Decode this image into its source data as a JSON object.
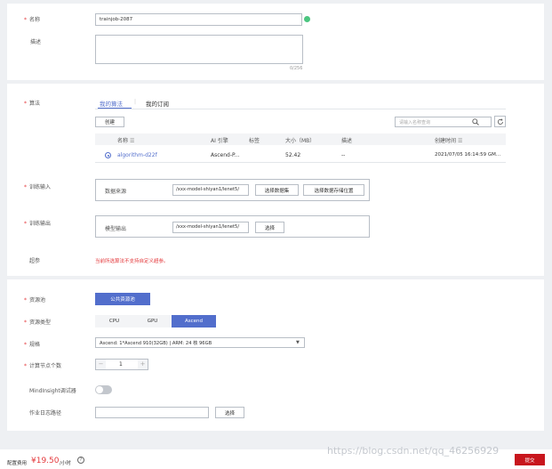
{
  "basic": {
    "name_label": "名称",
    "name_value": "trainjob-2087",
    "desc_label": "描述",
    "desc_count": "0/256"
  },
  "algo": {
    "label": "算法",
    "tabs": [
      "我的算法",
      "我的订阅"
    ],
    "create_btn": "创建",
    "search_placeholder": "请输入名称查询",
    "columns": [
      "名称",
      "AI 引擎",
      "标签",
      "大小（MB）",
      "描述",
      "创建时间"
    ],
    "row": {
      "name": "algorithm-d22f",
      "engine": "Ascend-P...",
      "tag": "",
      "size": "52.42",
      "desc": "--",
      "created": "2021/07/05 16:14:59 GM..."
    },
    "train_input_label": "训练输入",
    "data_source_label": "数据来源",
    "input_path": "/xxx-model-shiyan1/lenet5/",
    "select_dataset_btn": "选择数据集",
    "select_storage_btn": "选择数据存储位置",
    "train_output_label": "训练输出",
    "model_output_label": "模型输出",
    "output_path": "/xxx-model-shiyan1/lenet5/",
    "select_btn": "选择",
    "hyper_label": "超参",
    "hyper_note": "当前所选算法不支持自定义超参。"
  },
  "resource": {
    "pool_label": "资源池",
    "pool_btn": "公共资源池",
    "type_label": "资源类型",
    "types": [
      "CPU",
      "GPU",
      "Ascend"
    ],
    "spec_label": "规格",
    "spec_value": "Ascend: 1*Ascend 910(32GB) | ARM: 24 核 96GB",
    "nodes_label": "计算节点个数",
    "nodes_value": "1",
    "minus": "−",
    "plus": "+",
    "mindinsight_label": "MindInsight调试器",
    "log_label": "作业日志路径",
    "log_btn": "选择"
  },
  "footer": {
    "fee_label": "配置费用",
    "fee_value": "¥19.50",
    "fee_unit": "/小时",
    "submit": "提交",
    "watermark": "https://blog.csdn.net/qq_46256929"
  },
  "colors": {
    "accent": "#526ecc",
    "danger": "#e4393c",
    "success": "#4cc680"
  }
}
